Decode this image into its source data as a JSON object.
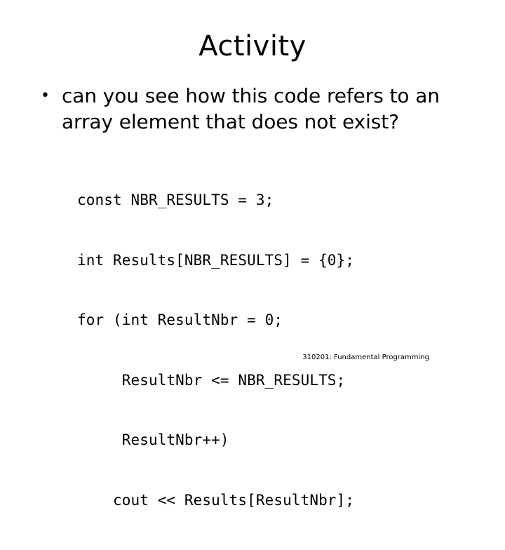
{
  "slide": {
    "title": "Activity",
    "background_color": "#ffffff",
    "text_color": "#000000"
  },
  "body": {
    "bullets": [
      {
        "marker": "•",
        "text": "can you see how this code refers to an array element that does not exist?"
      }
    ]
  },
  "code": {
    "language": "cpp",
    "lines": [
      "const NBR_RESULTS = 3;",
      "int Results[NBR_RESULTS] = {0};",
      "for (int ResultNbr = 0;",
      "     ResultNbr <= NBR_RESULTS;",
      "     ResultNbr++)",
      "    cout << Results[ResultNbr];"
    ]
  },
  "footer": {
    "text": "310201: Fundamental Programming"
  }
}
